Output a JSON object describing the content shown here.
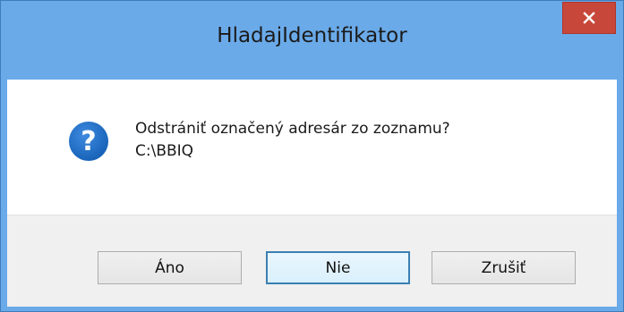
{
  "window": {
    "title": "HladajIdentifikator"
  },
  "dialog": {
    "icon": "question-icon",
    "message_line1": "Odstrániť označený adresár zo zoznamu?",
    "message_line2": "C:\\BBIQ"
  },
  "buttons": {
    "yes_label": "Áno",
    "no_label": "Nie",
    "cancel_label": "Zrušiť",
    "default": "no"
  },
  "colors": {
    "titlebar": "#6aaae9",
    "close_button": "#c7473a",
    "icon_blue": "#1f6fc4",
    "default_button_border": "#3c7fb1"
  }
}
